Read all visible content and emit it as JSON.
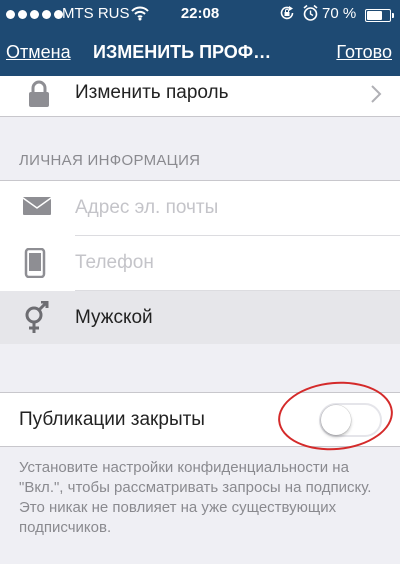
{
  "status_bar": {
    "carrier": "MTS RUS",
    "time": "22:08",
    "battery": "70 %",
    "battery_level": 0.7,
    "signal_bars": 5
  },
  "nav": {
    "cancel_label": "Отмена",
    "title": "ИЗМЕНИТЬ ПРОФ…",
    "done_label": "Готово"
  },
  "password_row": {
    "label": "Изменить пароль",
    "icon": "lock-icon"
  },
  "personal_info": {
    "header": "ЛИЧНАЯ ИНФОРМАЦИЯ",
    "email": {
      "value": "",
      "placeholder": "Адрес эл. почты",
      "icon": "mail-icon"
    },
    "phone": {
      "value": "",
      "placeholder": "Телефон",
      "icon": "phone-icon"
    },
    "gender": {
      "value": "Мужской",
      "icon": "gender-icon"
    }
  },
  "privacy": {
    "label": "Публикации закрыты",
    "enabled": false,
    "note": "Установите настройки конфиденциальности на \"Вкл.\", чтобы рассматривать запросы на подписку. Это никак не повлияет на уже существующих подписчиков."
  },
  "colors": {
    "nav_background": "#1e4a73",
    "page_background": "#efeff4",
    "annotation_ring": "#d42a2a"
  }
}
